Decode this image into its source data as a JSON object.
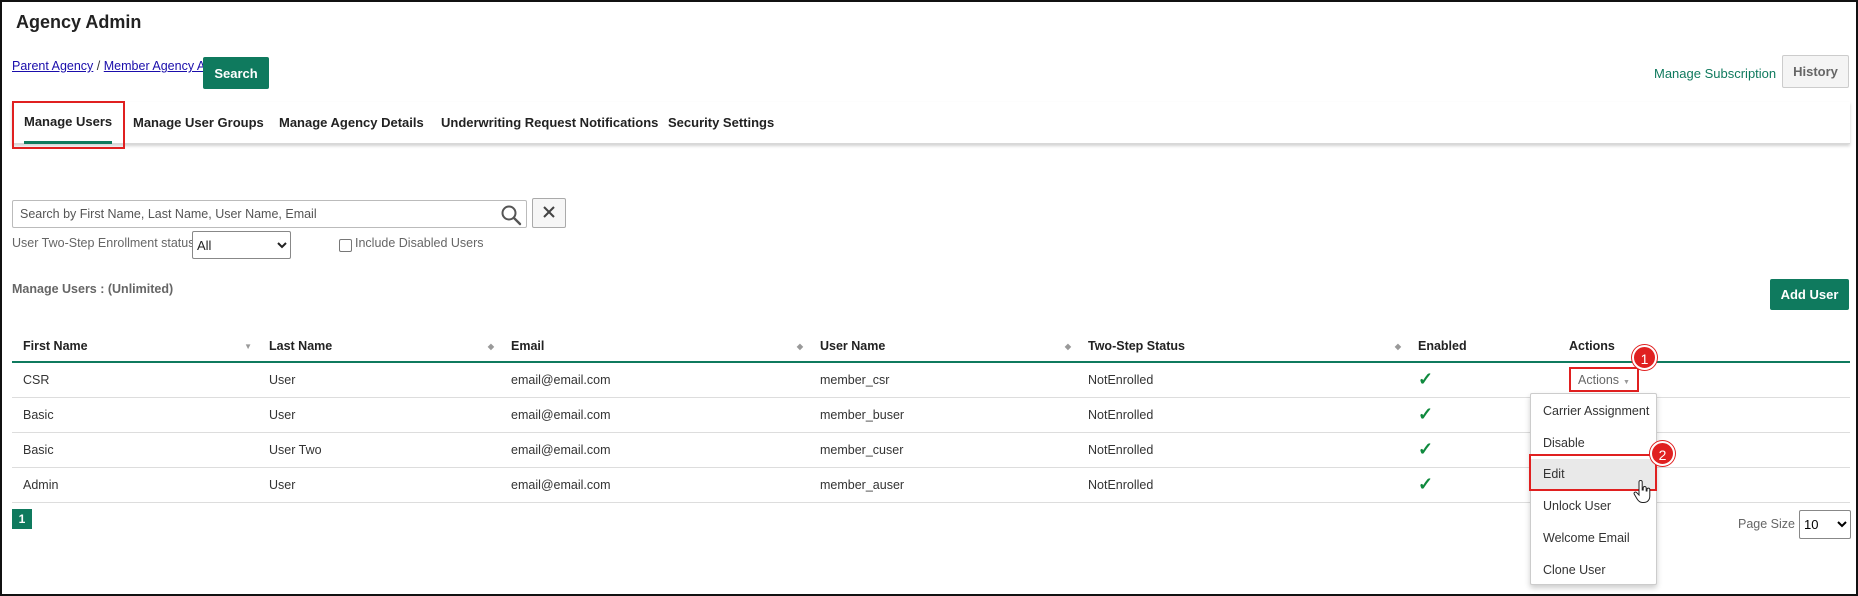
{
  "app": {
    "title": "Agency Admin"
  },
  "breadcrumb": {
    "parent": "Parent Agency",
    "separator": "/",
    "member": "Member Agency A"
  },
  "header": {
    "search_label": "Search",
    "manage_subscription": "Manage Subscription",
    "history_label": "History"
  },
  "tabs": [
    {
      "label": "Manage Users",
      "active": true
    },
    {
      "label": "Manage User Groups"
    },
    {
      "label": "Manage Agency Details"
    },
    {
      "label": "Underwriting Request Notifications"
    },
    {
      "label": "Security Settings"
    }
  ],
  "search": {
    "placeholder": "Search by First Name, Last Name, User Name, Email",
    "value": "",
    "clear_glyph": "✕"
  },
  "filters": {
    "enrollment_label": "User Two-Step Enrollment status",
    "enrollment_value": "All",
    "include_disabled_label": "Include Disabled Users",
    "include_disabled_checked": false
  },
  "section": {
    "label": "Manage Users : (Unlimited)",
    "add_user_label": "Add User"
  },
  "table": {
    "columns": [
      "First Name",
      "Last Name",
      "Email",
      "User Name",
      "Two-Step Status",
      "Enabled",
      "Actions"
    ],
    "rows": [
      {
        "first": "CSR",
        "last": "User",
        "email": "email@email.com",
        "username": "member_csr",
        "status": "NotEnrolled",
        "enabled": "✓"
      },
      {
        "first": "Basic",
        "last": "User",
        "email": "email@email.com",
        "username": "member_buser",
        "status": "NotEnrolled",
        "enabled": "✓"
      },
      {
        "first": "Basic",
        "last": "User Two",
        "email": "email@email.com",
        "username": "member_cuser",
        "status": "NotEnrolled",
        "enabled": "✓"
      },
      {
        "first": "Admin",
        "last": "User",
        "email": "email@email.com",
        "username": "member_auser",
        "status": "NotEnrolled",
        "enabled": "✓"
      }
    ],
    "actions_label": "Actions"
  },
  "actions_menu": {
    "items": [
      "Carrier Assignment",
      "Disable",
      "Edit",
      "Unlock User",
      "Welcome Email",
      "Clone User"
    ],
    "hovered": "Edit"
  },
  "annotations": {
    "step1": "1",
    "step2": "2"
  },
  "pagination": {
    "current_page": "1",
    "page_size_label": "Page Size",
    "page_size_value": "10"
  },
  "colors": {
    "accent": "#0f7a5e",
    "highlight": "#e02020",
    "check": "#0f8a3e"
  }
}
